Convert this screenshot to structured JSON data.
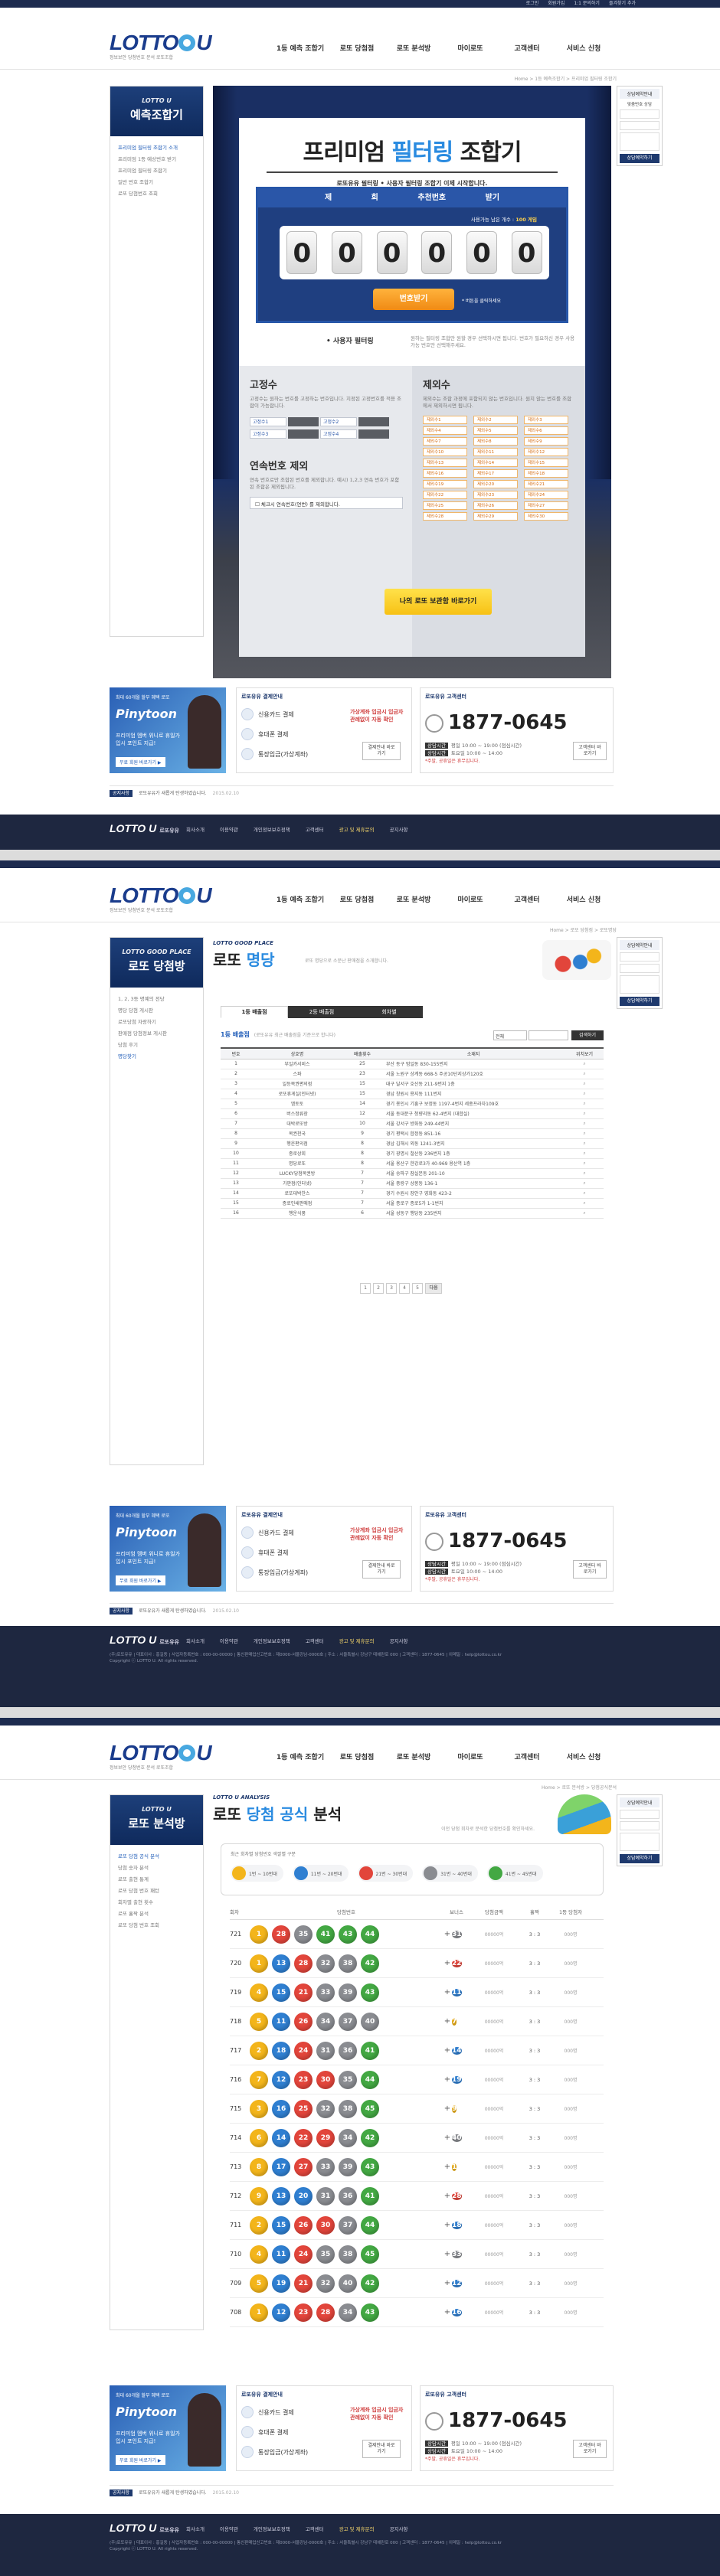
{
  "site": {
    "top_links": [
      "로그인",
      "회원가입",
      "1:1 문의하기",
      "즐겨찾기 추가"
    ],
    "logo_text": "LOTTO",
    "logo_suffix": "U",
    "logo_sub": "정보보안 당첨번호 분석 로또조합",
    "gnb": [
      "1등 예측 조합기",
      "로또 당첨점",
      "로또 분석방",
      "마이로또",
      "고객센터",
      "서비스 신청"
    ]
  },
  "quick": {
    "title": "상담예약안내",
    "sub": "맞춤번호 상담",
    "btn": "상담예약하기"
  },
  "page1": {
    "lnb_en": "LOTTO U",
    "lnb_title": "예측조합기",
    "lnb_items": [
      "프리미엄 필터링 조합기 소개",
      "프리미엄 1등 예상번호 받기",
      "프리미엄 필터링 조합기",
      "일반 번호 조합기",
      "로또 당첨번호 조회"
    ],
    "breadcrumb": "Home > 1등 예측조합기 > 프리미엄 필터링 조합기",
    "title_a": "프리미엄 ",
    "title_hl": "필터링",
    "title_b": " 조합기",
    "desc": "로또유유 필터링 • 사용자 필터링 조합기 이제 시작합니다.",
    "draw_title": "제 회 추천번호 받기",
    "count_label": "사용가능 남은 개수 :",
    "count_value": "100 게임",
    "digits": [
      "0",
      "0",
      "0",
      "0",
      "0",
      "0"
    ],
    "go_btn": "번호받기",
    "go_note": "* 버튼을 클릭하세요",
    "user_filter": "• 사용자 필터링",
    "user_filter_desc": "원하는 필터링 조합만 원할 경우 선택하시면 됩니다. 번호가 필요하신 경우 사용 가능 번호만 선택해주세요.",
    "fixed_title": "고정수",
    "fixed_desc": "고정수는 원하는 번호를 고정하는 번호입니다. 지정된 고정번호를 적용 조합이 가능합니다.",
    "fixed_cells": [
      "고정수1",
      "고정수2",
      "고정수3",
      "고정수4"
    ],
    "exclude_title": "제외수",
    "exclude_desc": "제외수는 조합 과정에 포함되지 않는 번호입니다. 원치 않는 번호를 조합에서 제외하시면 됩니다.",
    "exclude_cells": [
      "제외수1",
      "제외수2",
      "제외수3",
      "제외수4",
      "제외수5",
      "제외수6",
      "제외수7",
      "제외수8",
      "제외수9",
      "제외수10",
      "제외수11",
      "제외수12",
      "제외수13",
      "제외수14",
      "제외수15",
      "제외수16",
      "제외수17",
      "제외수18",
      "제외수19",
      "제외수20",
      "제외수21",
      "제외수22",
      "제외수23",
      "제외수24",
      "제외수25",
      "제외수26",
      "제외수27",
      "제외수28",
      "제외수29",
      "제외수30"
    ],
    "consec_title": "연속번호 제외",
    "consec_desc": "연속 번호로만 조합된 번호를 제외합니다. 예시) 1,2,3 연속 번호가 포함된 조합은 제외됩니다.",
    "consec_check": "☐ 체크시 연속번호(연번) 를 제외합니다.",
    "my_btn": "나의 로또 보관함 바로가기"
  },
  "page2": {
    "lnb_en": "LOTTO GOOD PLACE",
    "lnb_title": "로또 당첨방",
    "lnb_items": [
      "1, 2, 3등 명예의 전당",
      "명당 당첨 게시판",
      "로또당첨 자랑하기",
      "판매점 당첨정보 게시판",
      "당첨 후기",
      "명당찾기"
    ],
    "breadcrumb": "Home > 로또 당첨점 > 로또명당",
    "head_en": "LOTTO GOOD PLACE",
    "head_a": "로또 ",
    "head_hl": "명당",
    "head_sub": "로또 명당으로 소문난 판매점을 소개합니다.",
    "tabs": [
      "1등 배출점",
      "2등 배출점",
      "회차별"
    ],
    "list_title": "1등 배출점",
    "list_note": "(로또유유 최근 배출점을 기준으로 합니다)",
    "select": "전체",
    "search_btn": "검색하기",
    "columns": [
      "번호",
      "상호명",
      "배출횟수",
      "소재지",
      "위치보기"
    ],
    "rows": [
      {
        "no": "1",
        "name": "부일카서비스",
        "cnt": "25",
        "addr": "부산 동구 범일동 830-155번지"
      },
      {
        "no": "2",
        "name": "스파",
        "cnt": "23",
        "addr": "서울 노원구 상계동 668-5 주공10단지상가120호"
      },
      {
        "no": "3",
        "name": "일등복권편의점",
        "cnt": "15",
        "addr": "대구 달서구 호산동 211-9번지 1층"
      },
      {
        "no": "4",
        "name": "로또휴게실(인터넷)",
        "cnt": "15",
        "addr": "경남 창원시 용지동 111번지"
      },
      {
        "no": "5",
        "name": "엠토토",
        "cnt": "14",
        "addr": "경기 용인시 기흥구 보정동 1197-4번지 세종프라자109호"
      },
      {
        "no": "6",
        "name": "버스정류장",
        "cnt": "12",
        "addr": "서울 동대문구 청량리동 62-4번지 (대합실)"
      },
      {
        "no": "7",
        "name": "대박로또방",
        "cnt": "10",
        "addr": "서울 강서구 방화동 249-44번지"
      },
      {
        "no": "8",
        "name": "복권천국",
        "cnt": "9",
        "addr": "경기 평택시 합정동 851-16"
      },
      {
        "no": "9",
        "name": "행운편의점",
        "cnt": "8",
        "addr": "경남 김해시 외동 1241-3번지"
      },
      {
        "no": "10",
        "name": "종로상회",
        "cnt": "8",
        "addr": "경기 광명시 철산동 236번지 1층"
      },
      {
        "no": "11",
        "name": "명당로또",
        "cnt": "8",
        "addr": "서울 용산구 한강로3가 40-969 용산역 1층"
      },
      {
        "no": "12",
        "name": "LUCKY당첨복권방",
        "cnt": "7",
        "addr": "서울 송파구 잠실본동 201-10"
      },
      {
        "no": "13",
        "name": "가판점(인터넷)",
        "cnt": "7",
        "addr": "서울 중랑구 상봉동 136-1"
      },
      {
        "no": "14",
        "name": "로또대박찬스",
        "cnt": "7",
        "addr": "경기 수원시 장안구 영화동 423-2"
      },
      {
        "no": "15",
        "name": "종로인쇄판매점",
        "cnt": "7",
        "addr": "서울 종로구 종로5가 1-1번지"
      },
      {
        "no": "16",
        "name": "행운식품",
        "cnt": "6",
        "addr": "서울 성동구 행당동 235번지"
      }
    ],
    "pages": [
      "1",
      "2",
      "3",
      "4",
      "5",
      "다음"
    ]
  },
  "page3": {
    "lnb_en": "LOTTO U",
    "lnb_title": "로또 분석방",
    "lnb_items": [
      "로또 당첨 공식 분석",
      "당첨 숫자 분석",
      "로또 출현 통계",
      "로또 당첨 번호 패턴",
      "회차별 출현 횟수",
      "로또 홀짝 분석",
      "로또 당첨 번호 조회"
    ],
    "breadcrumb": "Home > 로또 분석방 > 당첨공식분석",
    "head_en": "LOTTO U ANALYSIS",
    "head_a": "로또 ",
    "head_hl": "당첨 공식",
    "head_b": " 분석",
    "head_sub": "이전 당첨 회차로 분석한 당첨번호를 확인하세요.",
    "legend_q": "최근 회차별 당첨번호 색깔별 구분",
    "legend": [
      "1번 ~ 10번대",
      "11번 ~ 20번대",
      "21번 ~ 30번대",
      "31번 ~ 40번대",
      "41번 ~ 45번대"
    ],
    "columns": [
      "회차",
      "당첨번호",
      "보너스",
      "당첨금액",
      "홀짝",
      "1등 당첨자"
    ],
    "rows": [
      {
        "r": "721",
        "b": [
          {
            "n": "1",
            "c": "y"
          },
          {
            "n": "28",
            "c": "r"
          },
          {
            "n": "35",
            "c": "k"
          },
          {
            "n": "41",
            "c": "g"
          },
          {
            "n": "43",
            "c": "g"
          },
          {
            "n": "44",
            "c": "g"
          }
        ],
        "bn": "31",
        "bc": "k"
      },
      {
        "r": "720",
        "b": [
          {
            "n": "1",
            "c": "y"
          },
          {
            "n": "13",
            "c": "b"
          },
          {
            "n": "28",
            "c": "r"
          },
          {
            "n": "32",
            "c": "k"
          },
          {
            "n": "38",
            "c": "k"
          },
          {
            "n": "42",
            "c": "g"
          }
        ],
        "bn": "22",
        "bc": "r"
      },
      {
        "r": "719",
        "b": [
          {
            "n": "4",
            "c": "y"
          },
          {
            "n": "15",
            "c": "b"
          },
          {
            "n": "21",
            "c": "r"
          },
          {
            "n": "33",
            "c": "k"
          },
          {
            "n": "39",
            "c": "k"
          },
          {
            "n": "43",
            "c": "g"
          }
        ],
        "bn": "11",
        "bc": "b"
      },
      {
        "r": "718",
        "b": [
          {
            "n": "5",
            "c": "y"
          },
          {
            "n": "11",
            "c": "b"
          },
          {
            "n": "26",
            "c": "r"
          },
          {
            "n": "34",
            "c": "k"
          },
          {
            "n": "37",
            "c": "k"
          },
          {
            "n": "40",
            "c": "k"
          }
        ],
        "bn": "7",
        "bc": "y"
      },
      {
        "r": "717",
        "b": [
          {
            "n": "2",
            "c": "y"
          },
          {
            "n": "18",
            "c": "b"
          },
          {
            "n": "24",
            "c": "r"
          },
          {
            "n": "31",
            "c": "k"
          },
          {
            "n": "36",
            "c": "k"
          },
          {
            "n": "41",
            "c": "g"
          }
        ],
        "bn": "14",
        "bc": "b"
      },
      {
        "r": "716",
        "b": [
          {
            "n": "7",
            "c": "y"
          },
          {
            "n": "12",
            "c": "b"
          },
          {
            "n": "23",
            "c": "r"
          },
          {
            "n": "30",
            "c": "r"
          },
          {
            "n": "35",
            "c": "k"
          },
          {
            "n": "44",
            "c": "g"
          }
        ],
        "bn": "19",
        "bc": "b"
      },
      {
        "r": "715",
        "b": [
          {
            "n": "3",
            "c": "y"
          },
          {
            "n": "16",
            "c": "b"
          },
          {
            "n": "25",
            "c": "r"
          },
          {
            "n": "32",
            "c": "k"
          },
          {
            "n": "38",
            "c": "k"
          },
          {
            "n": "45",
            "c": "g"
          }
        ],
        "bn": "9",
        "bc": "y"
      },
      {
        "r": "714",
        "b": [
          {
            "n": "6",
            "c": "y"
          },
          {
            "n": "14",
            "c": "b"
          },
          {
            "n": "22",
            "c": "r"
          },
          {
            "n": "29",
            "c": "r"
          },
          {
            "n": "34",
            "c": "k"
          },
          {
            "n": "42",
            "c": "g"
          }
        ],
        "bn": "40",
        "bc": "k"
      },
      {
        "r": "713",
        "b": [
          {
            "n": "8",
            "c": "y"
          },
          {
            "n": "17",
            "c": "b"
          },
          {
            "n": "27",
            "c": "r"
          },
          {
            "n": "33",
            "c": "k"
          },
          {
            "n": "39",
            "c": "k"
          },
          {
            "n": "43",
            "c": "g"
          }
        ],
        "bn": "1",
        "bc": "y"
      },
      {
        "r": "712",
        "b": [
          {
            "n": "9",
            "c": "y"
          },
          {
            "n": "13",
            "c": "b"
          },
          {
            "n": "20",
            "c": "b"
          },
          {
            "n": "31",
            "c": "k"
          },
          {
            "n": "36",
            "c": "k"
          },
          {
            "n": "41",
            "c": "g"
          }
        ],
        "bn": "28",
        "bc": "r"
      },
      {
        "r": "711",
        "b": [
          {
            "n": "2",
            "c": "y"
          },
          {
            "n": "15",
            "c": "b"
          },
          {
            "n": "26",
            "c": "r"
          },
          {
            "n": "30",
            "c": "r"
          },
          {
            "n": "37",
            "c": "k"
          },
          {
            "n": "44",
            "c": "g"
          }
        ],
        "bn": "18",
        "bc": "b"
      },
      {
        "r": "710",
        "b": [
          {
            "n": "4",
            "c": "y"
          },
          {
            "n": "11",
            "c": "b"
          },
          {
            "n": "24",
            "c": "r"
          },
          {
            "n": "35",
            "c": "k"
          },
          {
            "n": "38",
            "c": "k"
          },
          {
            "n": "45",
            "c": "g"
          }
        ],
        "bn": "33",
        "bc": "k"
      },
      {
        "r": "709",
        "b": [
          {
            "n": "5",
            "c": "y"
          },
          {
            "n": "19",
            "c": "b"
          },
          {
            "n": "21",
            "c": "r"
          },
          {
            "n": "32",
            "c": "k"
          },
          {
            "n": "40",
            "c": "k"
          },
          {
            "n": "42",
            "c": "g"
          }
        ],
        "bn": "12",
        "bc": "b"
      },
      {
        "r": "708",
        "b": [
          {
            "n": "1",
            "c": "y"
          },
          {
            "n": "12",
            "c": "b"
          },
          {
            "n": "23",
            "c": "r"
          },
          {
            "n": "28",
            "c": "r"
          },
          {
            "n": "34",
            "c": "k"
          },
          {
            "n": "43",
            "c": "g"
          }
        ],
        "bn": "16",
        "bc": "b"
      }
    ],
    "m1": "00000억",
    "m2": "3 : 3",
    "m3": "000명"
  },
  "promo": {
    "ad_sub": "최대 60개월 할부 혜택 로또",
    "ad_brand": "Pinytoon",
    "ad_txt": "프리미엄 멤버 위니로 휴일가입시 포인트 지급!",
    "ad_cta": "무료 회원 바로가기 ▶",
    "pay_head": "로또유유 결제안내",
    "pay_rows": [
      "신용카드 결제",
      "휴대폰 결제",
      "통장입금(가상계좌)"
    ],
    "pay_note": "가상계좌 입금시 입금자 관례없이 자동 확인",
    "pay_btn": "결제안내 바로가기",
    "cs_head": "로또유유 고객센터",
    "cs_tel": "1877-0645",
    "cs_h1": "평일 10:00 ~ 19:00 (점심시간)",
    "cs_h2": "토요일 10:00 ~ 14:00",
    "cs_h1_lab": "상담시간",
    "cs_h2_lab": "상담시간",
    "cs_sub": "*주말, 공휴일은 휴무입니다.",
    "cs_btn": "고객센터 바로가기"
  },
  "notice": {
    "label": "공지사항",
    "text": "로또유유가 새롭게 탄생하였습니다.",
    "date": "2015.02.10"
  },
  "footer": {
    "logo": "LOTTO U",
    "logo_sub": "로또유유",
    "links": [
      "회사소개",
      "이용약관",
      "개인정보보호정책",
      "고객센터",
      "광고 및 제휴문의",
      "공지사항"
    ],
    "info": "(주)로또유유 | 대표이사 : 홍길동 | 사업자등록번호 : 000-00-00000 | 통신판매업신고번호 : 제0000-서울강남-0000호 | 주소 : 서울특별시 강남구 테헤란로 000 | 고객센터 : 1877-0645 | 이메일 : help@lottou.co.kr",
    "copy": "Copyright ⓒ LOTTO U. All rights reserved."
  }
}
